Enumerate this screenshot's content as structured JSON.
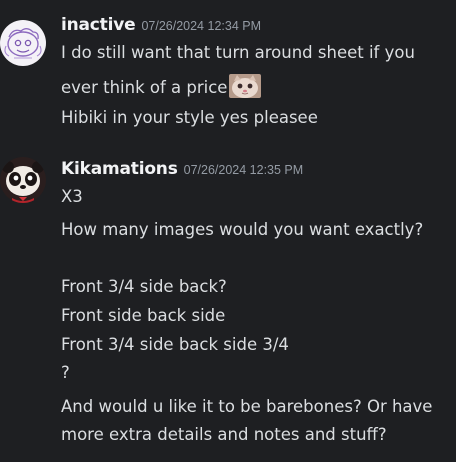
{
  "messages": [
    {
      "username": "inactive",
      "timestamp": "07/26/2024 12:34 PM",
      "avatar_icon": "sketch-doodle-avatar",
      "lines": [
        "I do still want that turn around sheet if you",
        "ever think of a price",
        "Hibiki in your style yes pleasee"
      ],
      "inline_emoji": "kitten-face-emoji"
    },
    {
      "username": "Kikamations",
      "timestamp": "07/26/2024 12:35 PM",
      "avatar_icon": "panda-character-avatar",
      "lines": [
        "X3",
        "How many images would you want exactly?",
        "Front 3/4 side back?",
        "Front side back side",
        "Front 3/4 side back side 3/4",
        "?",
        "And would u like it to be barebones? Or have",
        "more extra details and notes and stuff?"
      ]
    }
  ]
}
